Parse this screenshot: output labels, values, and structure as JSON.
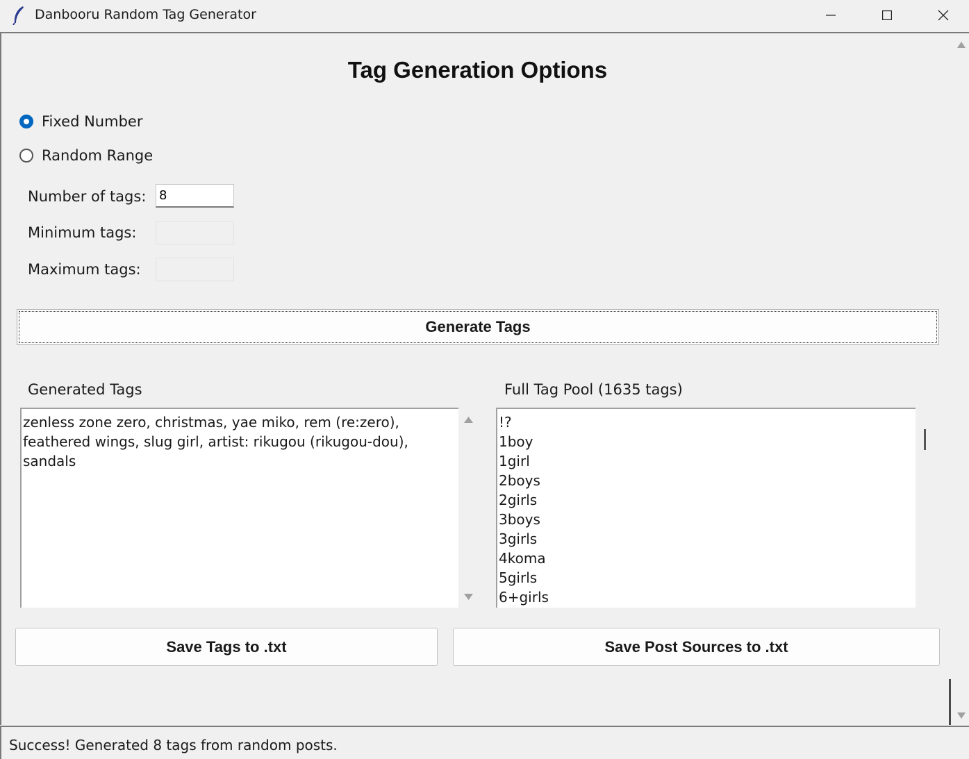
{
  "window": {
    "title": "Danbooru Random Tag Generator",
    "icon": "feather-icon",
    "controls": [
      "minimize-icon",
      "maximize-icon",
      "close-icon"
    ]
  },
  "heading": "Tag Generation Options",
  "mode": {
    "selected": "Fixed Number",
    "fixed_label": "Fixed Number",
    "range_label": "Random Range"
  },
  "fields": {
    "number_label": "Number of tags:",
    "number_value": "8",
    "min_label": "Minimum tags:",
    "min_value": "",
    "max_label": "Maximum tags:",
    "max_value": ""
  },
  "generate_button": "Generate Tags",
  "generated": {
    "label": "Generated Tags",
    "text": "zenless zone zero, christmas, yae miko, rem (re:zero), feathered wings, slug girl, artist: rikugou (rikugou-dou), sandals"
  },
  "pool": {
    "label": "Full Tag Pool (1635 tags)",
    "items": [
      "!?",
      "1boy",
      "1girl",
      "2boys",
      "2girls",
      "3boys",
      "3girls",
      "4koma",
      "5girls",
      "6+girls"
    ]
  },
  "buttons": {
    "save_tags": "Save Tags to .txt",
    "save_sources": "Save Post Sources to .txt"
  },
  "status": "Success! Generated 8 tags from random posts.",
  "colors": {
    "accent": "#0067c0",
    "background": "#f0f0f0"
  }
}
